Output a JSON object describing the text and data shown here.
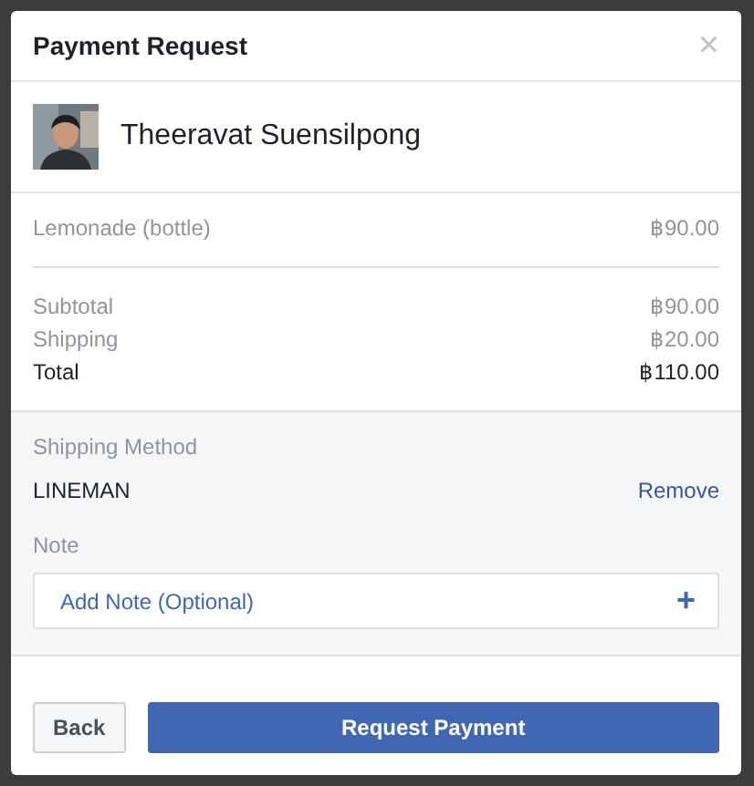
{
  "dialog": {
    "title": "Payment Request",
    "close": "×"
  },
  "recipient": {
    "name": "Theeravat Suensilpong"
  },
  "items": [
    {
      "label": "Lemonade (bottle)",
      "amount": "฿90.00"
    }
  ],
  "summary": [
    {
      "label": "Subtotal",
      "amount": "฿90.00",
      "kind": "sub"
    },
    {
      "label": "Shipping",
      "amount": "฿20.00",
      "kind": "sub"
    },
    {
      "label": "Total",
      "amount": "฿110.00",
      "kind": "total"
    }
  ],
  "shipping": {
    "label": "Shipping Method",
    "method": "LINEMAN",
    "action": "Remove"
  },
  "note": {
    "label": "Note",
    "placeholder": "Add Note (Optional)",
    "add": "+"
  },
  "buttons": {
    "back": "Back",
    "primary": "Request Payment"
  }
}
